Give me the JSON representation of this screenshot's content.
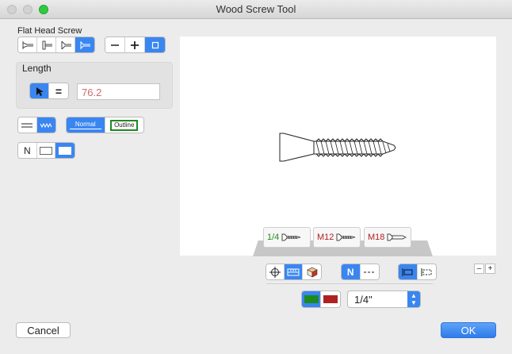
{
  "window": {
    "title": "Wood Screw Tool"
  },
  "head_type": {
    "label": "Flat Head Screw"
  },
  "length": {
    "label": "Length",
    "value": "76.2",
    "equals": "="
  },
  "thread_style": {
    "normal": "Normal",
    "outline": "Outline"
  },
  "view_mode": {
    "n": "N"
  },
  "display_toggle": {
    "n": "N"
  },
  "size_cards": [
    {
      "label": "1/4",
      "color": "#1e8a1e"
    },
    {
      "label": "M12",
      "color": "#b02020"
    },
    {
      "label": "M18",
      "color": "#b02020"
    }
  ],
  "size_select": {
    "value": "1/4\""
  },
  "zoom": {
    "minus": "–",
    "plus": "+"
  },
  "buttons": {
    "cancel": "Cancel",
    "ok": "OK"
  },
  "colors": {
    "accent": "#3a86f1",
    "green": "#1e8a1e",
    "red": "#b02020"
  }
}
